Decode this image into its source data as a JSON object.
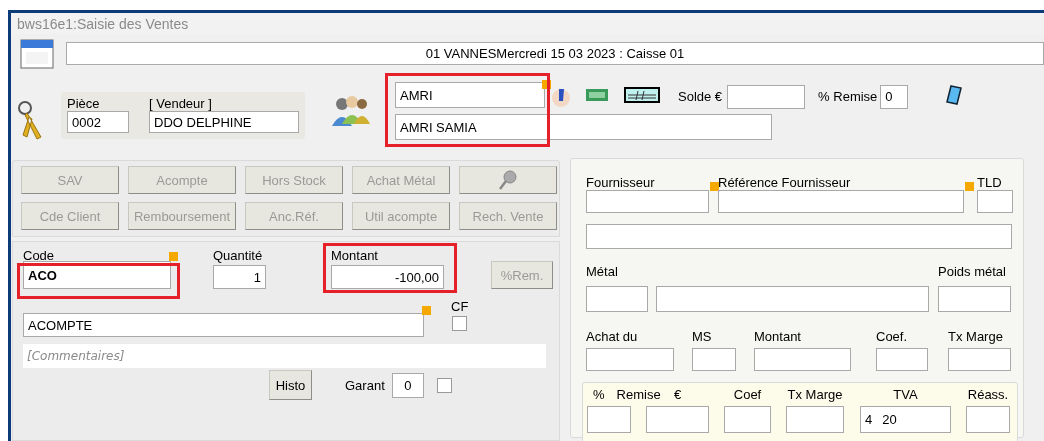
{
  "window": {
    "title": "bws16e1:Saisie des Ventes"
  },
  "header": {
    "text": "01 VANNESMercredi 15 03 2023 : Caisse 01"
  },
  "piece": {
    "label": "Pièce",
    "value": "0002"
  },
  "vendeur": {
    "label": "[ Vendeur ]",
    "value": "DDO DELPHINE"
  },
  "client": {
    "code": "AMRI",
    "name": "AMRI SAMIA",
    "highlighted": true,
    "marker": true
  },
  "solde": {
    "label": "Solde €"
  },
  "remise": {
    "label": "% Remise",
    "value": "0"
  },
  "action_buttons": [
    {
      "kind": "text",
      "label": "SAV",
      "disabled": true
    },
    {
      "kind": "text",
      "label": "Acompte",
      "disabled": true
    },
    {
      "kind": "text",
      "label": "Hors Stock",
      "disabled": true
    },
    {
      "kind": "text",
      "label": "Achat Métal",
      "disabled": true
    },
    {
      "kind": "search",
      "disabled": true
    },
    {
      "kind": "text",
      "label": "Cde Client",
      "disabled": true
    },
    {
      "kind": "text",
      "label": "Remboursement",
      "disabled": true
    },
    {
      "kind": "text",
      "label": "Anc.Réf.",
      "disabled": true
    },
    {
      "kind": "text",
      "label": "Util acompte",
      "disabled": true
    },
    {
      "kind": "text",
      "label": "Rech. Vente",
      "disabled": true
    }
  ],
  "line": {
    "code": {
      "label": "Code",
      "value": "ACO",
      "highlighted": true,
      "marker": true
    },
    "quantite": {
      "label": "Quantité",
      "value": "1"
    },
    "montant": {
      "label": "Montant",
      "value": "-100,00",
      "highlighted": true
    },
    "rem_button": {
      "label": "%Rem.",
      "disabled": true
    },
    "designation": {
      "value": "ACOMPTE",
      "marker": true
    },
    "cf": {
      "label": "CF",
      "checked": false
    },
    "comment": {
      "placeholder": "[Commentaires]"
    },
    "histo_button": {
      "label": "Histo"
    },
    "garant": {
      "label": "Garant",
      "value": "0",
      "checked": false
    }
  },
  "supplier_rows": [
    [
      {
        "label": "Fournisseur",
        "marker": true
      },
      {
        "label": "Référence Fournisseur",
        "marker": true
      },
      {
        "label": "TLD"
      }
    ],
    [
      {
        "kind": "input"
      }
    ],
    [
      {
        "label": "Métal"
      },
      {
        "kind": "input"
      },
      {
        "label": "Poids métal"
      }
    ],
    [
      {
        "label": "Achat du"
      },
      {
        "label": "MS"
      },
      {
        "label": "Montant"
      },
      {
        "label": "Coef."
      },
      {
        "label": "Tx Marge"
      }
    ]
  ],
  "price_fields": [
    {
      "label": "%",
      "label_2": "Remise"
    },
    {
      "label": "€"
    },
    {
      "label": "Coef"
    },
    {
      "label": "Tx Marge"
    },
    {
      "label": "TVA",
      "code": "4",
      "value": "20"
    },
    {
      "label": "Réass."
    }
  ]
}
